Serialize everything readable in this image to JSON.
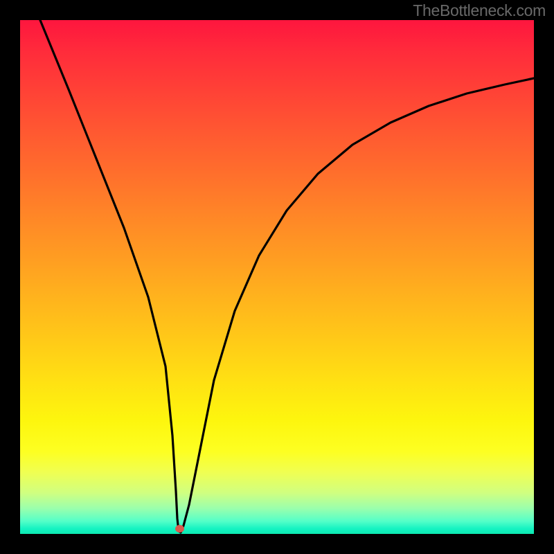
{
  "watermark": "TheBottleneck.com",
  "chart_data": {
    "type": "line",
    "title": "",
    "xlabel": "",
    "ylabel": "",
    "xlim": [
      0,
      100
    ],
    "ylim": [
      0,
      100
    ],
    "grid": false,
    "legend": false,
    "background": "rainbow-gradient-vertical",
    "series": [
      {
        "name": "curve",
        "color": "#000000",
        "x": [
          4,
          8,
          12,
          16,
          20,
          24,
          27,
          29,
          30,
          31,
          32,
          34,
          36,
          40,
          45,
          50,
          55,
          60,
          65,
          70,
          75,
          80,
          85,
          90,
          95,
          100
        ],
        "y": [
          100,
          87,
          74,
          60,
          47,
          33,
          20,
          10,
          4,
          0,
          4,
          14,
          26,
          43,
          56,
          65,
          71,
          76,
          79.5,
          82,
          84,
          85.5,
          86.7,
          87.6,
          88.3,
          88.8
        ]
      }
    ],
    "markers": [
      {
        "name": "minimum-dot",
        "x": 30.7,
        "y": 0.3,
        "color": "#d95a4e"
      }
    ]
  }
}
